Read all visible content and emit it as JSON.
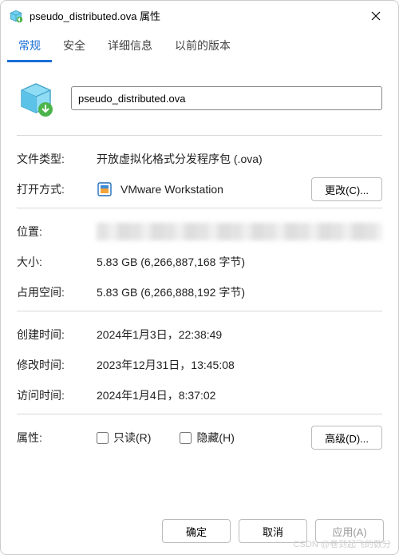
{
  "window": {
    "title": "pseudo_distributed.ova 属性"
  },
  "tabs": [
    {
      "label": "常规",
      "active": true
    },
    {
      "label": "安全",
      "active": false
    },
    {
      "label": "详细信息",
      "active": false
    },
    {
      "label": "以前的版本",
      "active": false
    }
  ],
  "filename": "pseudo_distributed.ova",
  "labels": {
    "filetype": "文件类型:",
    "openwith": "打开方式:",
    "location": "位置:",
    "size": "大小:",
    "disk": "占用空间:",
    "created": "创建时间:",
    "modified": "修改时间:",
    "accessed": "访问时间:",
    "attributes": "属性:"
  },
  "values": {
    "filetype": "开放虚拟化格式分发程序包 (.ova)",
    "openwith_app": "VMware Workstation",
    "size": "5.83 GB (6,266,887,168 字节)",
    "disk": "5.83 GB (6,266,888,192 字节)",
    "created": "2024年1月3日，22:38:49",
    "modified": "2023年12月31日，13:45:08",
    "accessed": "2024年1月4日，8:37:02"
  },
  "buttons": {
    "change": "更改(C)...",
    "advanced": "高级(D)...",
    "ok": "确定",
    "cancel": "取消",
    "apply": "应用(A)"
  },
  "checkboxes": {
    "readonly": "只读(R)",
    "hidden": "隐藏(H)"
  },
  "watermark": "CSDN @卷到起飞的数分"
}
